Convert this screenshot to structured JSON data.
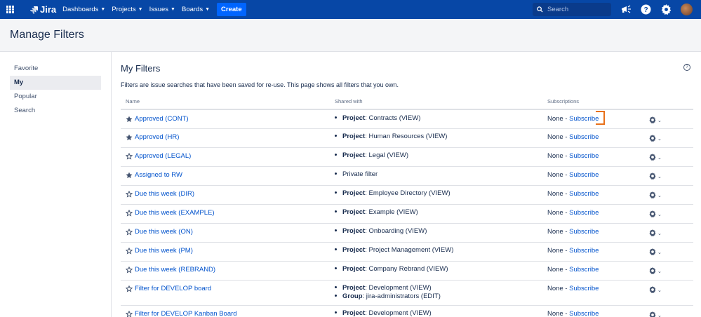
{
  "nav": {
    "logo_text": "Jira",
    "items": [
      {
        "label": "Dashboards"
      },
      {
        "label": "Projects"
      },
      {
        "label": "Issues"
      },
      {
        "label": "Boards"
      }
    ],
    "create_label": "Create",
    "search_placeholder": "Search",
    "bg_color": "#0747A6"
  },
  "header": {
    "title": "Manage Filters"
  },
  "sidebar": {
    "items": [
      {
        "label": "Favorite",
        "active": false
      },
      {
        "label": "My",
        "active": true
      },
      {
        "label": "Popular",
        "active": false
      },
      {
        "label": "Search",
        "active": false
      }
    ]
  },
  "main": {
    "title": "My Filters",
    "description": "Filters are issue searches that have been saved for re-use. This page shows all filters that you own.",
    "columns": {
      "name": "Name",
      "shared": "Shared with",
      "subscriptions": "Subscriptions"
    },
    "rows": [
      {
        "favorite": true,
        "name": "Approved (CONT)",
        "shared": [
          {
            "kind": "Project",
            "value": ": Contracts (VIEW)"
          }
        ],
        "subs_none": "None - ",
        "subs_link": "Subscribe"
      },
      {
        "favorite": true,
        "name": "Approved (HR)",
        "shared": [
          {
            "kind": "Project",
            "value": ": Human Resources (VIEW)"
          }
        ],
        "subs_none": "None - ",
        "subs_link": "Subscribe"
      },
      {
        "favorite": false,
        "name": "Approved (LEGAL)",
        "shared": [
          {
            "kind": "Project",
            "value": ": Legal (VIEW)"
          }
        ],
        "subs_none": "None - ",
        "subs_link": "Subscribe"
      },
      {
        "favorite": true,
        "name": "Assigned to RW",
        "shared": [
          {
            "kind": "",
            "value": "Private filter"
          }
        ],
        "subs_none": "None - ",
        "subs_link": "Subscribe"
      },
      {
        "favorite": false,
        "name": "Due this week (DIR)",
        "shared": [
          {
            "kind": "Project",
            "value": ": Employee Directory (VIEW)"
          }
        ],
        "subs_none": "None - ",
        "subs_link": "Subscribe"
      },
      {
        "favorite": false,
        "name": "Due this week (EXAMPLE)",
        "shared": [
          {
            "kind": "Project",
            "value": ": Example (VIEW)"
          }
        ],
        "subs_none": "None - ",
        "subs_link": "Subscribe"
      },
      {
        "favorite": false,
        "name": "Due this week (ON)",
        "shared": [
          {
            "kind": "Project",
            "value": ": Onboarding (VIEW)"
          }
        ],
        "subs_none": "None - ",
        "subs_link": "Subscribe"
      },
      {
        "favorite": false,
        "name": "Due this week (PM)",
        "shared": [
          {
            "kind": "Project",
            "value": ": Project Management (VIEW)"
          }
        ],
        "subs_none": "None - ",
        "subs_link": "Subscribe"
      },
      {
        "favorite": false,
        "name": "Due this week (REBRAND)",
        "shared": [
          {
            "kind": "Project",
            "value": ": Company Rebrand (VIEW)"
          }
        ],
        "subs_none": "None - ",
        "subs_link": "Subscribe"
      },
      {
        "favorite": false,
        "name": "Filter for DEVELOP board",
        "shared": [
          {
            "kind": "Project",
            "value": ": Development (VIEW)"
          },
          {
            "kind": "Group",
            "value": ": jira-administrators (EDIT)"
          }
        ],
        "subs_none": "None - ",
        "subs_link": "Subscribe"
      },
      {
        "favorite": false,
        "name": "Filter for DEVELOP Kanban Board",
        "shared": [
          {
            "kind": "Project",
            "value": ": Development (VIEW)"
          }
        ],
        "subs_none": "None - ",
        "subs_link": "Subscribe"
      }
    ]
  },
  "colors": {
    "link": "#0052CC",
    "highlight": "#E8711A"
  }
}
